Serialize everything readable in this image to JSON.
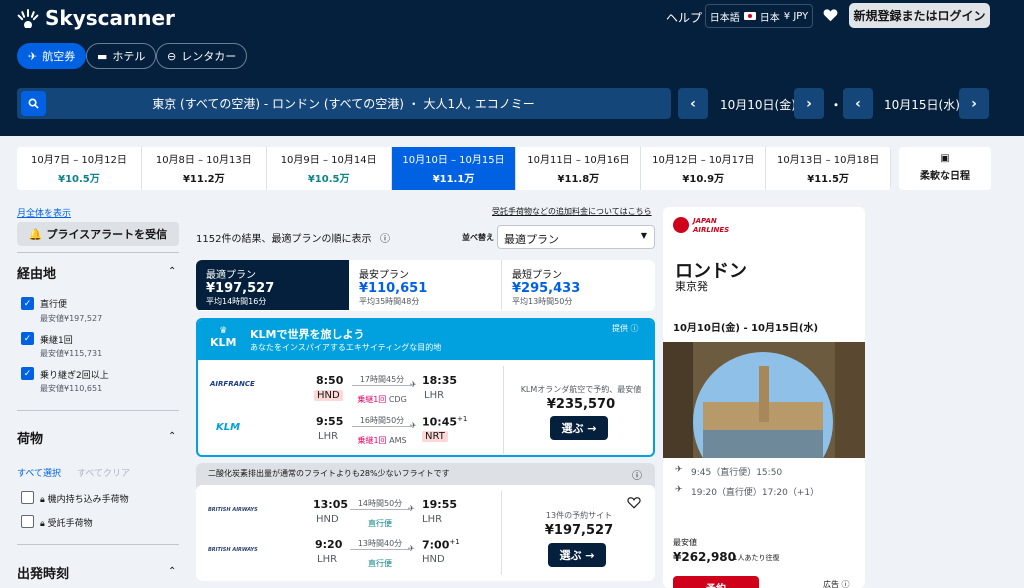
{
  "header": {
    "brand": "Skyscanner",
    "help": "ヘルプ",
    "locale": "日本語",
    "country": "日本",
    "currency": "¥ JPY",
    "login": "新規登録またはログイン"
  },
  "nav": {
    "flights": "航空券",
    "hotels": "ホテル",
    "cars": "レンタカー"
  },
  "search": {
    "summary": "東京 (すべての空港) - ロンドン (すべての空港) ・ 大人1人, エコノミー",
    "depart": "10月10日(金)",
    "ret": "10月15日(水)",
    "sep": "・"
  },
  "dates": [
    {
      "range": "10月7日 – 10月12日",
      "price": "¥10.5万"
    },
    {
      "range": "10月8日 – 10月13日",
      "price": "¥11.2万"
    },
    {
      "range": "10月9日 – 10月14日",
      "price": "¥10.5万"
    },
    {
      "range": "10月10日 – 10月15日",
      "price": "¥11.1万"
    },
    {
      "range": "10月11日 – 10月16日",
      "price": "¥11.8万"
    },
    {
      "range": "10月12日 – 10月17日",
      "price": "¥10.9万"
    },
    {
      "range": "10月13日 – 10月18日",
      "price": "¥11.5万"
    }
  ],
  "flexible": "柔軟な日程",
  "sidebar": {
    "month": "月全体を表示",
    "alert": "プライスアラートを受信",
    "stops_title": "経由地",
    "stops": [
      {
        "label": "直行便",
        "sub": "最安値¥197,527"
      },
      {
        "label": "乗継1回",
        "sub": "最安値¥115,731"
      },
      {
        "label": "乗り継ぎ2回以上",
        "sub": "最安値¥110,651"
      }
    ],
    "bag_title": "荷物",
    "select_all": "すべて選択",
    "clear_all": "すべてクリア",
    "carry": "機内持ち込み手荷物",
    "checked": "受託手荷物",
    "dep_title": "出発時刻"
  },
  "results": {
    "count": "1152件の結果、最適プランの順に表示",
    "fees": "受託手荷物などの追加料金についてはこちら",
    "sort_label": "並べ替え",
    "sort_value": "最適プラン"
  },
  "tabs": [
    {
      "label": "最適プラン",
      "price": "¥197,527",
      "sub": "平均14時間16分"
    },
    {
      "label": "最安プラン",
      "price": "¥110,651",
      "sub": "平均35時間48分"
    },
    {
      "label": "最短プラン",
      "price": "¥295,433",
      "sub": "平均13時間50分"
    }
  ],
  "ad": {
    "title": "KLMで世界を旅しよう",
    "sub": "あなたをインスパイアするエキサイティングな目的地",
    "provided": "提供",
    "logo": "KLM",
    "out": {
      "dep": "8:50",
      "dep_apt": "HND",
      "dur": "17時間45分",
      "stop": "乗継1回",
      "via": "CDG",
      "arr": "18:35",
      "arr_apt": "LHR",
      "airline": "AIRFRANCE"
    },
    "ret": {
      "dep": "9:55",
      "dep_apt": "LHR",
      "dur": "16時間50分",
      "stop": "乗継1回",
      "via": "AMS",
      "arr": "10:45",
      "plus": "+1",
      "arr_apt": "NRT",
      "airline": "KLM"
    },
    "note": "KLMオランダ航空で予約、最安値",
    "price": "¥235,570",
    "btn": "選ぶ →"
  },
  "co2": "二酸化炭素排出量が通常のフライトよりも28%少ないフライトです",
  "flight": {
    "out": {
      "dep": "13:05",
      "dep_apt": "HND",
      "dur": "14時間50分",
      "stop": "直行便",
      "arr": "19:55",
      "arr_apt": "LHR"
    },
    "ret": {
      "dep": "9:20",
      "dep_apt": "LHR",
      "dur": "13時間40分",
      "stop": "直行便",
      "arr": "7:00",
      "plus": "+1",
      "arr_apt": "HND"
    },
    "airline": "BRITISH AIRWAYS",
    "sites": "13件の予約サイト",
    "price": "¥197,527",
    "btn": "選ぶ →"
  },
  "right": {
    "airline1": "JAPAN",
    "airline2": "AIRLINES",
    "city": "ロンドン",
    "from": "東京発",
    "dates": "10月10日(金) - 10月15日(水)",
    "leg1": "9:45（直行便）15:50",
    "leg2": "19:20（直行便）17:20（+1）",
    "cheap": "最安値",
    "price": "¥262,980",
    "per": "1人あたり往復",
    "book": "予約",
    "adlabel": "広告"
  },
  "colors": {
    "navy": "#05203c",
    "blue": "#0062e3",
    "klm": "#00a1de",
    "red": "#e70866"
  }
}
